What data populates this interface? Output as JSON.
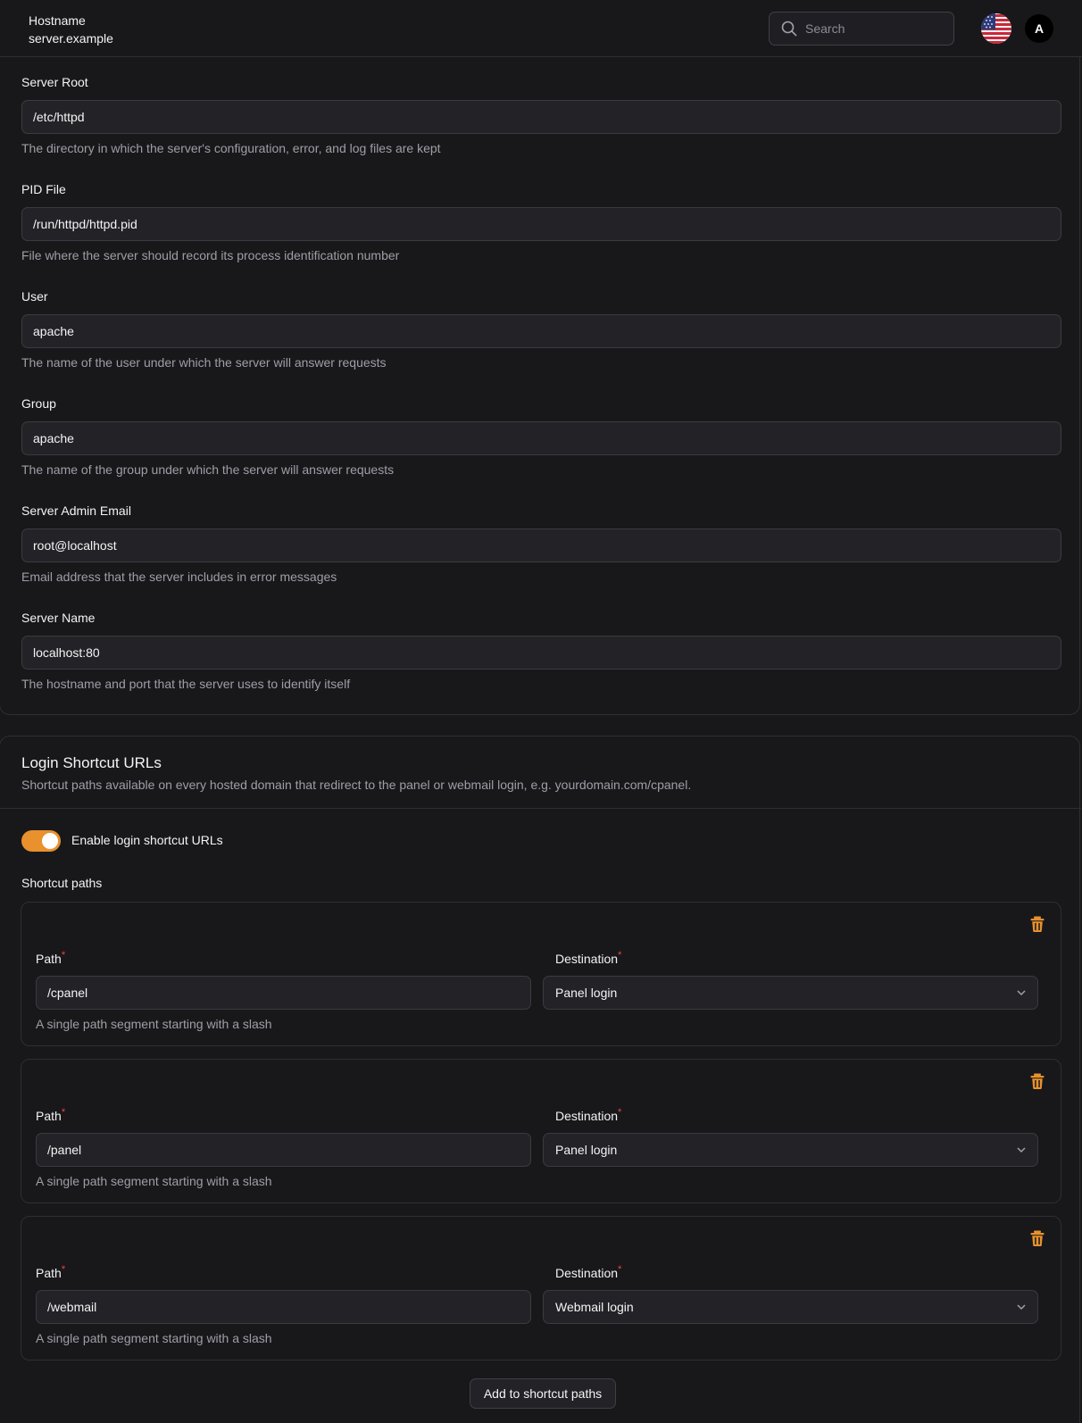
{
  "header": {
    "hostname_label": "Hostname",
    "hostname_value": "server.example",
    "search_placeholder": "Search",
    "avatar_initial": "A"
  },
  "server_settings": [
    {
      "label": "Server Root",
      "value": "/etc/httpd",
      "help": "The directory in which the server's configuration, error, and log files are kept"
    },
    {
      "label": "PID File",
      "value": "/run/httpd/httpd.pid",
      "help": "File where the server should record its process identification number"
    },
    {
      "label": "User",
      "value": "apache",
      "help": "The name of the user under which the server will answer requests"
    },
    {
      "label": "Group",
      "value": "apache",
      "help": "The name of the group under which the server will answer requests"
    },
    {
      "label": "Server Admin Email",
      "value": "root@localhost",
      "help": "Email address that the server includes in error messages"
    },
    {
      "label": "Server Name",
      "value": "localhost:80",
      "help": "The hostname and port that the server uses to identify itself"
    }
  ],
  "login_shortcuts": {
    "title": "Login Shortcut URLs",
    "description": "Shortcut paths available on every hosted domain that redirect to the panel or webmail login, e.g. yourdomain.com/cpanel.",
    "toggle_label": "Enable login shortcut URLs",
    "toggle_on": true,
    "paths_label": "Shortcut paths",
    "path_label": "Path",
    "destination_label": "Destination",
    "path_help": "A single path segment starting with a slash",
    "required_marker": "*",
    "entries": [
      {
        "path": "/cpanel",
        "destination": "Panel login"
      },
      {
        "path": "/panel",
        "destination": "Panel login"
      },
      {
        "path": "/webmail",
        "destination": "Webmail login"
      }
    ],
    "add_button": "Add to shortcut paths"
  },
  "colors": {
    "background": "#18181b",
    "accent": "#e8912d",
    "required": "#ef4444",
    "muted_text": "#9e9ea7"
  },
  "icons": [
    "search-icon",
    "us-flag-icon",
    "trash-icon",
    "chevron-down-icon"
  ]
}
